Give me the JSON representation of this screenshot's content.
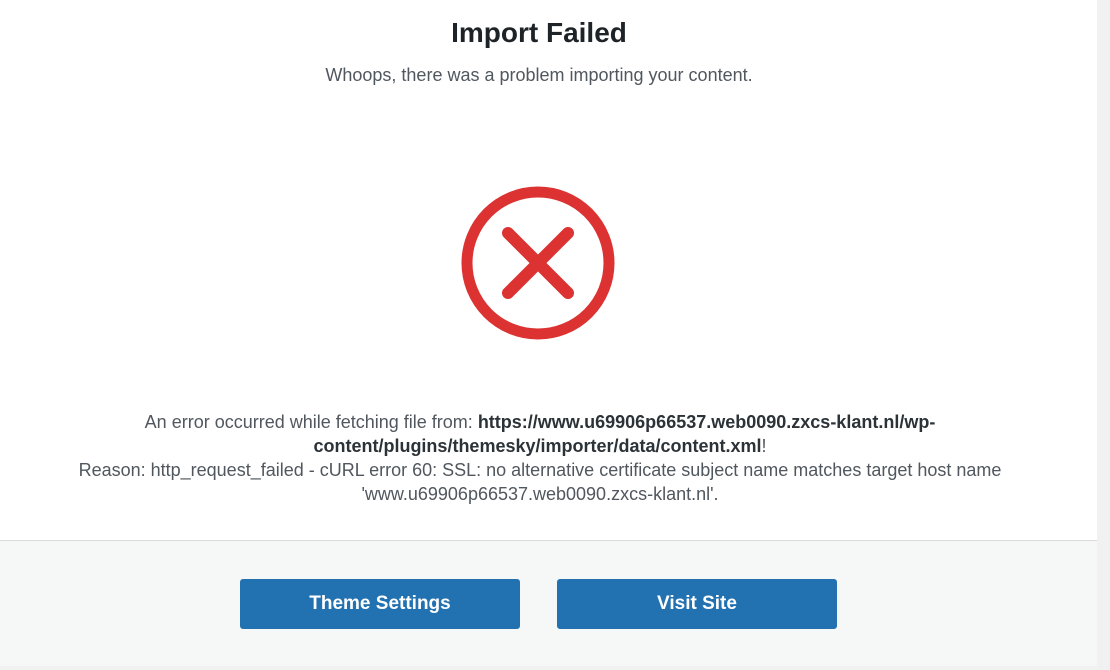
{
  "header": {
    "title": "Import Failed",
    "subtitle": "Whoops, there was a problem importing your content."
  },
  "error": {
    "icon": "error-x-circle-icon",
    "icon_color": "#dc3232",
    "prefix": "An error occurred while fetching file from: ",
    "url": "https://www.u69906p66537.web0090.zxcs-klant.nl/wp-content/plugins/themesky/importer/data/content.xml",
    "url_suffix": "!",
    "reason": "Reason: http_request_failed - cURL error 60: SSL: no alternative certificate subject name matches target host name 'www.u69906p66537.web0090.zxcs-klant.nl'."
  },
  "footer": {
    "theme_settings_label": "Theme Settings",
    "visit_site_label": "Visit Site",
    "button_color": "#2271b1"
  }
}
